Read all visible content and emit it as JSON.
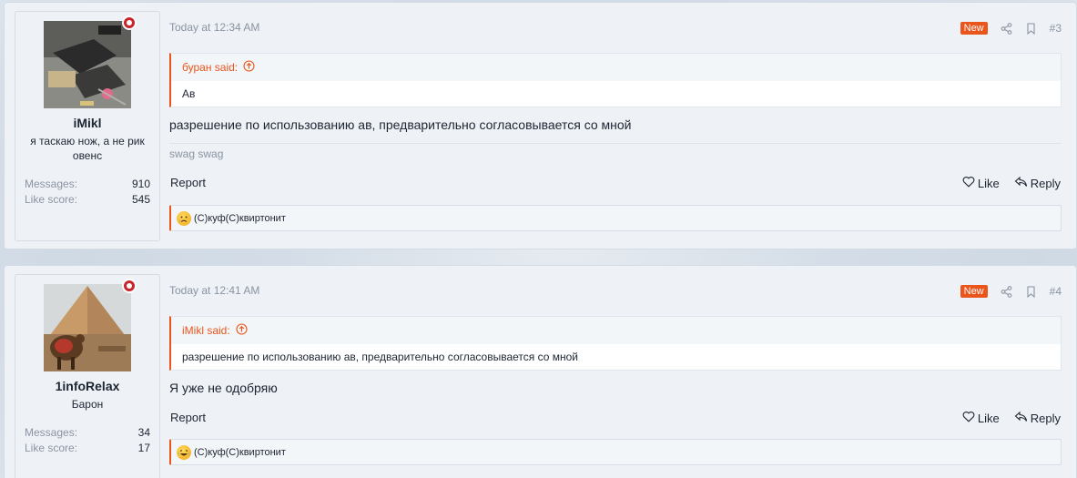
{
  "colors": {
    "accent": "#e9551b",
    "online": "#c9242b",
    "muted": "#8a94a3",
    "text": "#1d2533"
  },
  "posts": [
    {
      "date": "Today at 12:34 AM",
      "badge": "New",
      "post_number": "#3",
      "user": {
        "name": "iMikl",
        "title": "я таскаю нож, а не рик овенс",
        "messages_label": "Messages:",
        "messages_value": "910",
        "likes_label": "Like score:",
        "likes_value": "545"
      },
      "quote": {
        "author_said": "буран said:",
        "text": "Ав"
      },
      "body": "разрешение по использованию ав, предварительно согласовывается со мной",
      "signature": "swag swag",
      "actions": {
        "report": "Report",
        "like": "Like",
        "reply": "Reply"
      },
      "reaction_users": "(C)куф(C)квиртонит",
      "reaction_icon": "sad-emoji-icon"
    },
    {
      "date": "Today at 12:41 AM",
      "badge": "New",
      "post_number": "#4",
      "user": {
        "name": "1infoRelax",
        "title": "Барон",
        "messages_label": "Messages:",
        "messages_value": "34",
        "likes_label": "Like score:",
        "likes_value": "17"
      },
      "quote": {
        "author_said": "iMikl said:",
        "text": "разрешение по использованию ав, предварительно согласовывается со мной"
      },
      "body": "Я уже не одобряю",
      "actions": {
        "report": "Report",
        "like": "Like",
        "reply": "Reply"
      },
      "reaction_users": "(C)куф(C)квиртонит",
      "reaction_icon": "laughing-emoji-icon"
    }
  ]
}
